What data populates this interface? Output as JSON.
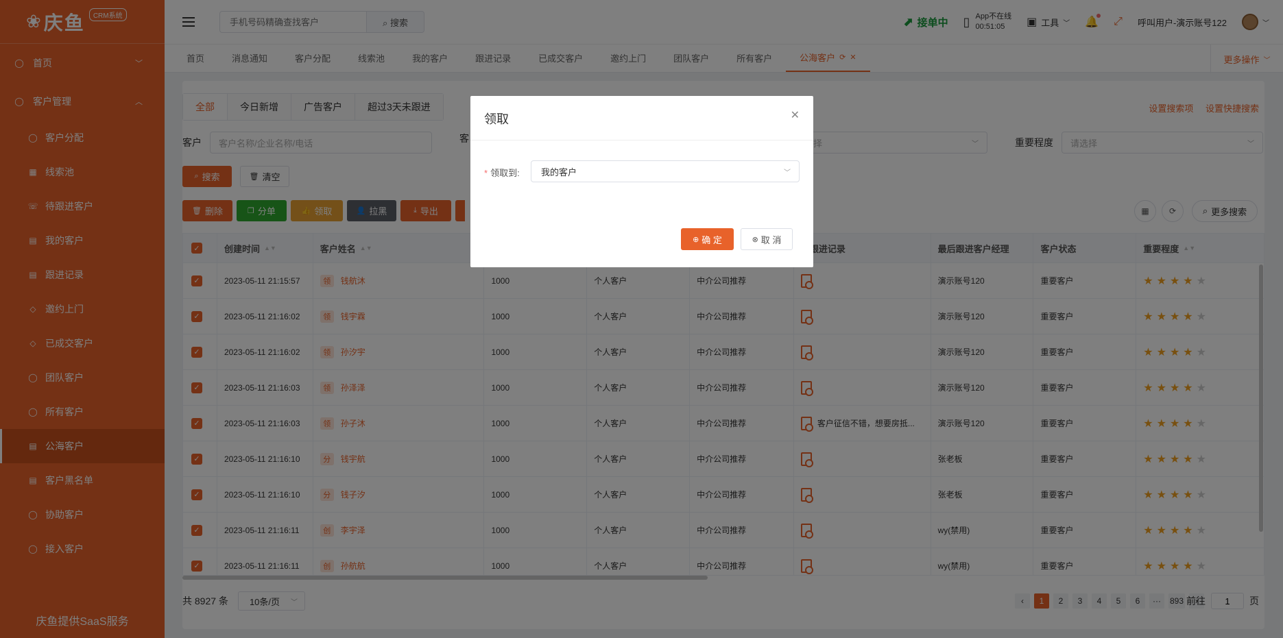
{
  "sidebar": {
    "brand": "庆鱼",
    "badge": "CRM系统",
    "top_items": [
      {
        "label": "首页",
        "icon": "user-icon"
      },
      {
        "label": "客户管理",
        "icon": "user-icon"
      }
    ],
    "sub_items": [
      {
        "label": "客户分配",
        "icon": "user-icon"
      },
      {
        "label": "线索池",
        "icon": "grid-icon"
      },
      {
        "label": "待跟进客户",
        "icon": "phone-icon"
      },
      {
        "label": "我的客户",
        "icon": "document-icon"
      },
      {
        "label": "跟进记录",
        "icon": "document-icon"
      },
      {
        "label": "邀约上门",
        "icon": "tag-icon"
      },
      {
        "label": "已成交客户",
        "icon": "tag-icon"
      },
      {
        "label": "团队客户",
        "icon": "user-icon"
      },
      {
        "label": "所有客户",
        "icon": "user-icon"
      },
      {
        "label": "公海客户",
        "icon": "document-icon",
        "active": true
      },
      {
        "label": "客户黑名单",
        "icon": "document-icon"
      },
      {
        "label": "协助客户",
        "icon": "user-icon"
      },
      {
        "label": "接入客户",
        "icon": "user-icon"
      }
    ],
    "footer": "庆鱼提供SaaS服务"
  },
  "header": {
    "search_placeholder": "手机号码精确查找客户",
    "search_button": "搜索",
    "accept_label": "接单中",
    "app_status_line1": "App不在线",
    "app_status_line2": "00:51:05",
    "tools_label": "工具",
    "user_label": "呼叫用户-演示账号122"
  },
  "tabs": {
    "items": [
      "首页",
      "消息通知",
      "客户分配",
      "线索池",
      "我的客户",
      "跟进记录",
      "已成交客户",
      "邀约上门",
      "团队客户",
      "所有客户"
    ],
    "active": "公海客户",
    "more_ops": "更多操作"
  },
  "main": {
    "subtabs": [
      "全部",
      "今日新增",
      "广告客户",
      "超过3天未跟进"
    ],
    "link_search_settings": "设置搜索项",
    "link_quick_search": "设置快捷搜索",
    "filter_customer_label": "客户",
    "filter_customer_placeholder": "客户名称/企业名称/电话",
    "filter_second_label": "客",
    "filter_select_partial": "择",
    "filter_importance_label": "重要程度",
    "filter_importance_placeholder": "请选择",
    "btn_search": "搜索",
    "btn_clear": "清空",
    "btn_delete": "删除",
    "btn_assign": "分单",
    "btn_claim": "领取",
    "btn_blacklist": "拉黑",
    "btn_export": "导出",
    "btn_more_search": "更多搜索",
    "columns": {
      "created": "创建时间",
      "name": "客户姓名",
      "last_record": "后跟进记录",
      "manager": "最后跟进客户经理",
      "status": "客户状态",
      "importance": "重要程度"
    },
    "rows": [
      {
        "created": "2023-05-11 21:15:57",
        "tag": "领",
        "name": "钱航沐",
        "amount": "1000",
        "type": "个人客户",
        "source": "中介公司推荐",
        "record": "",
        "manager": "演示账号120",
        "status": "重要客户",
        "stars": 4
      },
      {
        "created": "2023-05-11 21:16:02",
        "tag": "领",
        "name": "钱宇霖",
        "amount": "1000",
        "type": "个人客户",
        "source": "中介公司推荐",
        "record": "",
        "manager": "演示账号120",
        "status": "重要客户",
        "stars": 4
      },
      {
        "created": "2023-05-11 21:16:02",
        "tag": "领",
        "name": "孙汐宇",
        "amount": "1000",
        "type": "个人客户",
        "source": "中介公司推荐",
        "record": "",
        "manager": "演示账号120",
        "status": "重要客户",
        "stars": 4
      },
      {
        "created": "2023-05-11 21:16:03",
        "tag": "领",
        "name": "孙泽泽",
        "amount": "1000",
        "type": "个人客户",
        "source": "中介公司推荐",
        "record": "",
        "manager": "演示账号120",
        "status": "重要客户",
        "stars": 4
      },
      {
        "created": "2023-05-11 21:16:03",
        "tag": "领",
        "name": "孙子沐",
        "amount": "1000",
        "type": "个人客户",
        "source": "中介公司推荐",
        "record": "客户征信不错，想要房抵...",
        "manager": "演示账号120",
        "status": "重要客户",
        "stars": 4
      },
      {
        "created": "2023-05-11 21:16:10",
        "tag": "分",
        "name": "钱宇航",
        "amount": "1000",
        "type": "个人客户",
        "source": "中介公司推荐",
        "record": "",
        "manager": "张老板",
        "status": "重要客户",
        "stars": 4
      },
      {
        "created": "2023-05-11 21:16:10",
        "tag": "分",
        "name": "钱子汐",
        "amount": "1000",
        "type": "个人客户",
        "source": "中介公司推荐",
        "record": "",
        "manager": "张老板",
        "status": "重要客户",
        "stars": 4
      },
      {
        "created": "2023-05-11 21:16:11",
        "tag": "创",
        "name": "李宇泽",
        "amount": "1000",
        "type": "个人客户",
        "source": "中介公司推荐",
        "record": "",
        "manager": "wy(禁用)",
        "status": "重要客户",
        "stars": 4
      },
      {
        "created": "2023-05-11 21:16:11",
        "tag": "创",
        "name": "孙航航",
        "amount": "1000",
        "type": "个人客户",
        "source": "中介公司推荐",
        "record": "",
        "manager": "wy(禁用)",
        "status": "重要客户",
        "stars": 4
      }
    ],
    "total": "共 8927 条",
    "page_size": "10条/页",
    "pages": [
      "1",
      "2",
      "3",
      "4",
      "5",
      "6",
      "···",
      "893"
    ],
    "current_page": "1",
    "goto_label": "前往",
    "goto_value": "1",
    "goto_suffix": "页"
  },
  "dialog": {
    "title": "领取",
    "field_label": "领取到:",
    "field_value": "我的客户",
    "ok": "确 定",
    "cancel": "取 消"
  },
  "colors": {
    "accent": "#e8622a",
    "green": "#1a9a3c"
  }
}
